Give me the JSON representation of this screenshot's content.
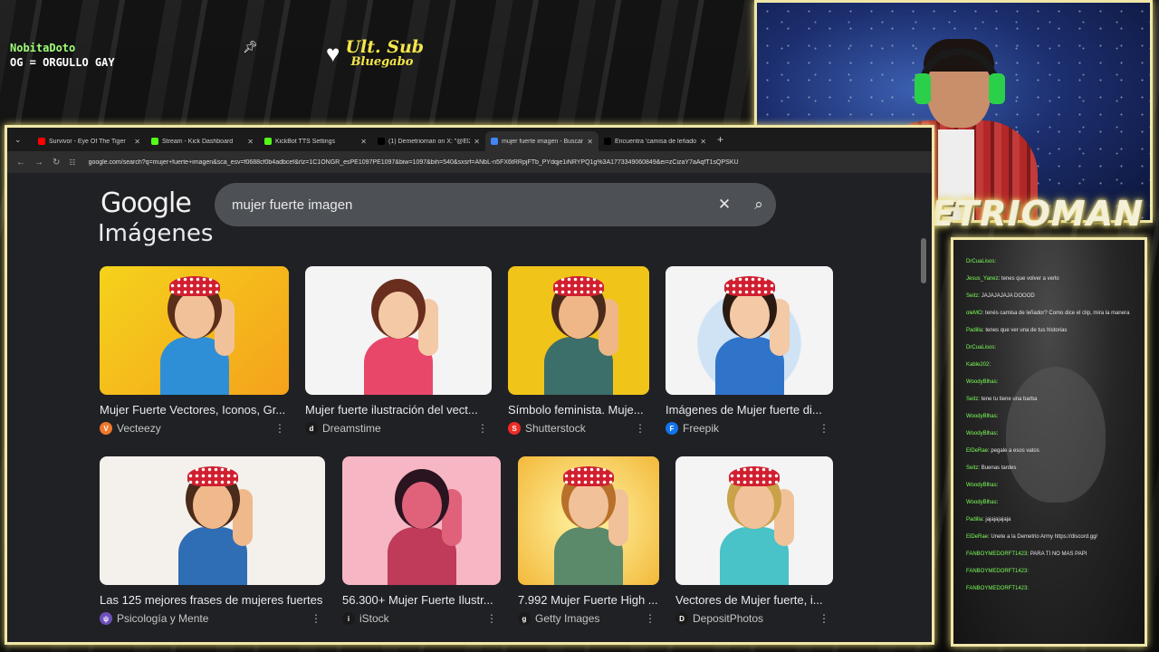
{
  "overlay": {
    "username": "NobitaDoto",
    "message": "OG = ORGULLO GAY",
    "ult_sub_title": "Ult. Sub",
    "ult_sub_name": "Bluegabo",
    "streamer_name": "DEMETRIOMAN"
  },
  "browser": {
    "tabs": [
      {
        "title": "Survivor - Eye Of The Tiger",
        "icon_color": "#ff0000",
        "active": false
      },
      {
        "title": "Stream - Kick Dashboard",
        "icon_color": "#53fc18",
        "active": false
      },
      {
        "title": "KickBot TTS Settings",
        "icon_color": "#53fc18",
        "active": false
      },
      {
        "title": "(1) Demetrioman on X: \"@El2m",
        "icon_color": "#000000",
        "active": false
      },
      {
        "title": "mujer fuerte imagen - Buscar c",
        "icon_color": "#4285f4",
        "active": true
      },
      {
        "title": "Encuentra 'camisa de leñador' o",
        "icon_color": "#000000",
        "active": false
      }
    ],
    "url": "google.com/search?q=mujer+fuerte+imagen&sca_esv=f0688cf0b4adbcef&rlz=1C1ONGR_esPE1097PE1097&biw=1097&bih=540&sxsrf=ANbL-n5FX6tRRpjFTb_PYdqje1iNRYPQ1g%3A1773349060849&ei=zCizaY7aAqfT1sQPSKU"
  },
  "google": {
    "logo": "Google",
    "query": "mujer fuerte imagen",
    "section_title": "Imágenes"
  },
  "results": [
    {
      "title": "Mujer Fuerte Vectores, Iconos, Gr...",
      "source": "Vecteezy",
      "src_color": "#f0772a",
      "src_glyph": "V"
    },
    {
      "title": "Mujer fuerte ilustración del vect...",
      "source": "Dreamstime",
      "src_color": "#1a1a1a",
      "src_glyph": "d"
    },
    {
      "title": "Símbolo feminista. Muje...",
      "source": "Shutterstock",
      "src_color": "#ee2b24",
      "src_glyph": "S"
    },
    {
      "title": "Imágenes de Mujer fuerte di...",
      "source": "Freepik",
      "src_color": "#1273eb",
      "src_glyph": "F"
    },
    {
      "title": "Las 125 mejores frases de mujeres fuertes",
      "source": "Psicología y Mente",
      "src_color": "#6b4fbb",
      "src_glyph": "ψ"
    },
    {
      "title": "56.300+ Mujer Fuerte Ilustr...",
      "source": "iStock",
      "src_color": "#1a1a1a",
      "src_glyph": "i"
    },
    {
      "title": "7.992 Mujer Fuerte High ...",
      "source": "Getty Images",
      "src_color": "#1a1a1a",
      "src_glyph": "g"
    },
    {
      "title": "Vectores de Mujer fuerte, i...",
      "source": "DepositPhotos",
      "src_color": "#1a1a1a",
      "src_glyph": "D"
    }
  ],
  "chat": [
    {
      "user": "DrCuaLisos",
      "text": ""
    },
    {
      "user": "Jesus_Yanez",
      "text": "tenes que volver a verlo"
    },
    {
      "user": "Seitz",
      "text": "JAJAJAJAJA DOOOD"
    },
    {
      "user": "oleMO",
      "text": "tenés camisa de leñador? Como dice el clip, mira la manera"
    },
    {
      "user": "Padilla",
      "text": "tenes que ver una de tus historias"
    },
    {
      "user": "DrCuaLisos",
      "text": ""
    },
    {
      "user": "Kable202",
      "text": ""
    },
    {
      "user": "WoodyBlhas",
      "text": ""
    },
    {
      "user": "Seitz",
      "text": "tene tu tiene una barba"
    },
    {
      "user": "WoodyBlhas",
      "text": ""
    },
    {
      "user": "WoodyBlhas",
      "text": ""
    },
    {
      "user": "ElDeRae",
      "text": "pegale a esos vatos"
    },
    {
      "user": "Seitz",
      "text": "Buenas tardes"
    },
    {
      "user": "WoodyBlhas",
      "text": ""
    },
    {
      "user": "WoodyBlhas",
      "text": ""
    },
    {
      "user": "Padilla",
      "text": "jajajajajaja"
    },
    {
      "user": "ElDeRae",
      "text": "Unete a la Demetrio Army https://discord.gg/"
    },
    {
      "user": "FANBOYMEDORFT1423",
      "text": "PARA TI NO MAS PAPI"
    },
    {
      "user": "FANBOYMEDORFT1423",
      "text": ""
    },
    {
      "user": "FANBOYMEDORFT1423",
      "text": ""
    }
  ]
}
